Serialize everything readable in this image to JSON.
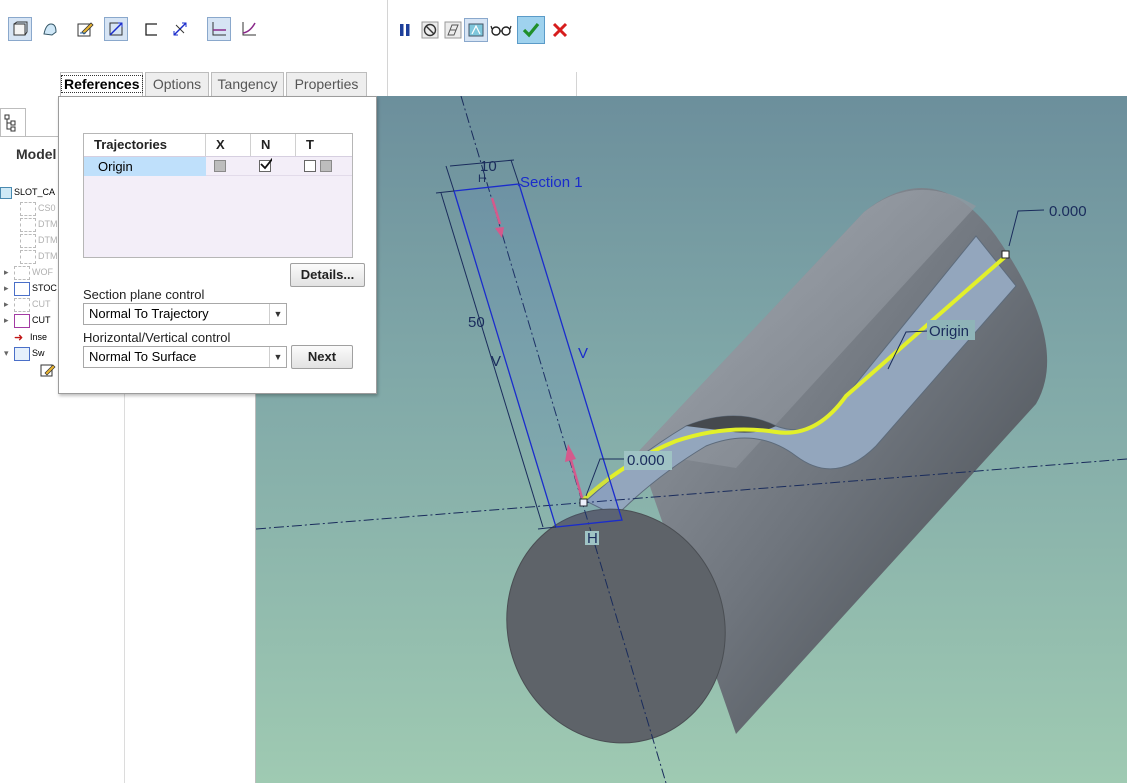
{
  "toolbar": {
    "icons_left": [
      "solid-icon",
      "surface-icon",
      "sketch-icon",
      "section-orient-icon",
      "open-section-icon",
      "flip-icon",
      "constant-section-icon",
      "variable-section-icon"
    ],
    "icons_right": [
      "pause-icon",
      "no-preview-icon",
      "preview-icon",
      "verify-icon",
      "glasses-icon",
      "ok-icon",
      "cancel-icon"
    ]
  },
  "tabs": [
    {
      "label": "References",
      "active": true
    },
    {
      "label": "Options",
      "active": false
    },
    {
      "label": "Tangency",
      "active": false
    },
    {
      "label": "Properties",
      "active": false
    }
  ],
  "tree": {
    "tab_label": "Model",
    "items": [
      "SLOT_CA",
      "CS0",
      "DTM",
      "DTM",
      "DTM",
      "WOF",
      "STOC",
      "CUT",
      "CUT",
      "Inse",
      "Sw"
    ]
  },
  "references": {
    "table_headers": [
      "Trajectories",
      "X",
      "N",
      "T"
    ],
    "rows": [
      {
        "name": "Origin",
        "x": false,
        "n": true,
        "t": false
      }
    ],
    "details_button": "Details...",
    "section_plane_label": "Section plane control",
    "section_plane_value": "Normal To Trajectory",
    "hv_control_label": "Horizontal/Vertical control",
    "hv_control_value": "Normal To Surface",
    "next_button": "Next"
  },
  "viewport": {
    "section_label": "Section 1",
    "dim_width": "10",
    "dim_height": "50",
    "dim_value_top": "0.000",
    "dim_value_bottom": "0.000",
    "trajectory_label": "Origin",
    "v_label": "V",
    "h_label": "H",
    "colors": {
      "trajectory": "#e2f02a",
      "sketch": "#1a2ccc",
      "arrow": "#d45a8c",
      "body": "#7d848d"
    }
  }
}
